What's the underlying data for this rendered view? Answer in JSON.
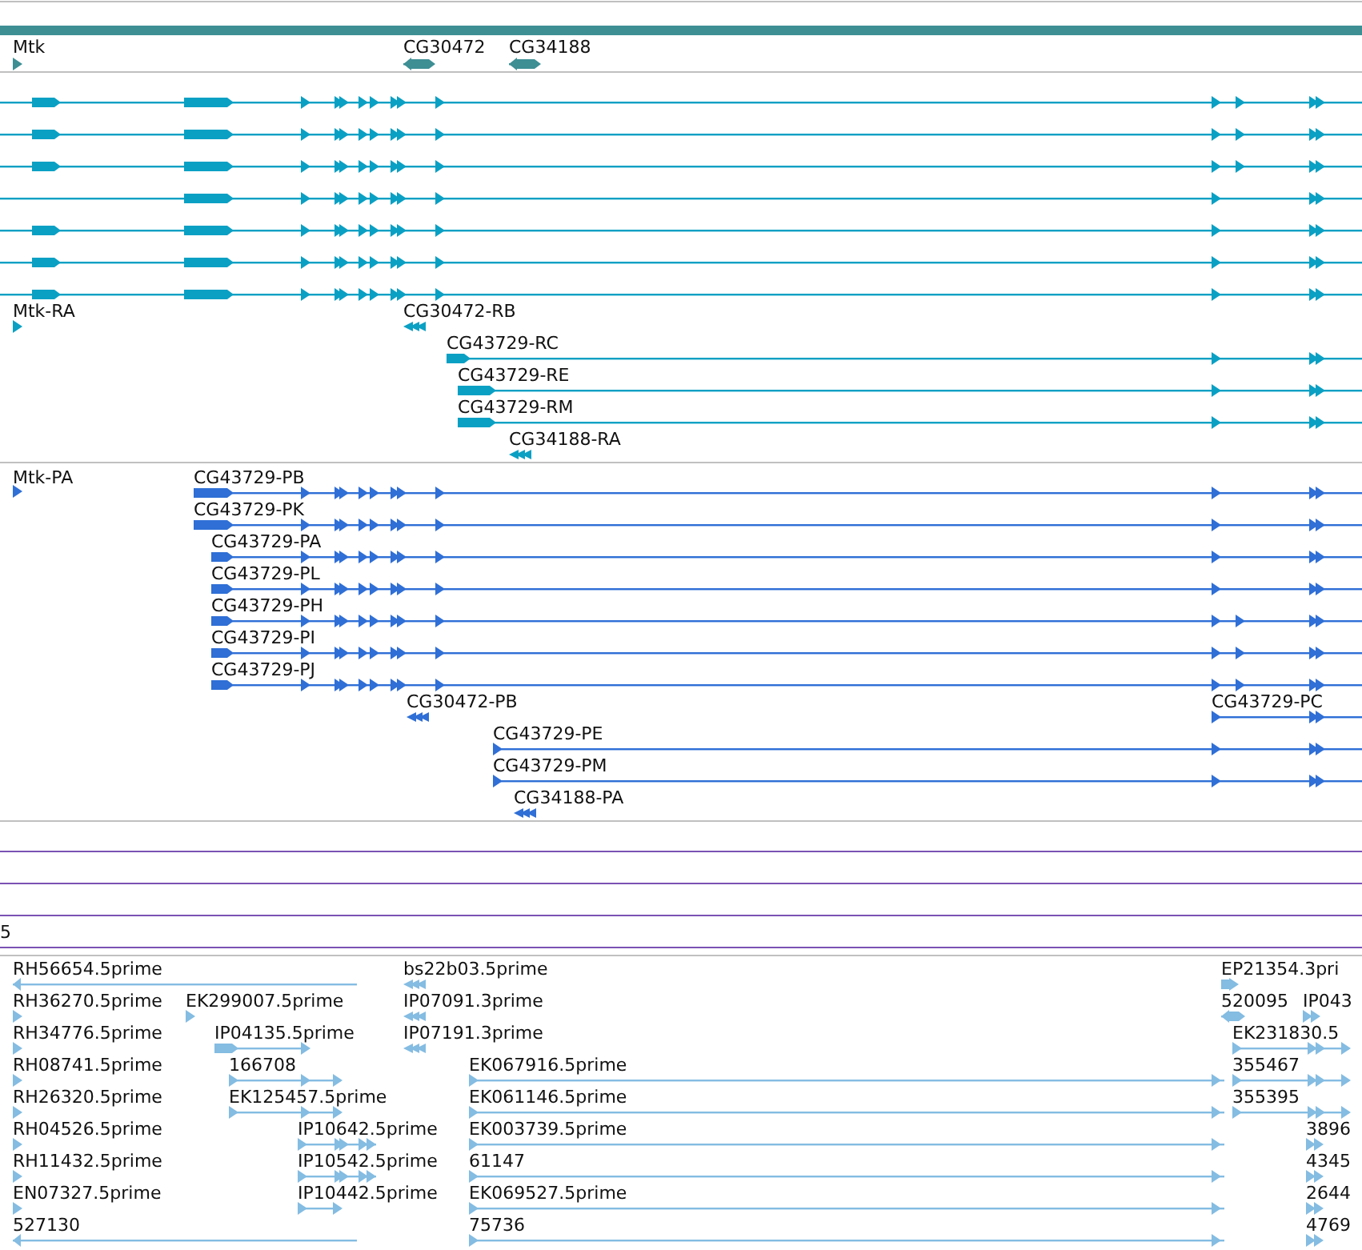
{
  "tracks": [
    {
      "kind": "genes",
      "color": "#3d8f94",
      "features": [
        {
          "label": "Mtk"
        },
        {
          "label": "CG30472"
        },
        {
          "label": "CG34188"
        }
      ]
    },
    {
      "kind": "transcripts",
      "color": "#0aa0c4",
      "features": [
        {
          "label": "Mtk-RA"
        },
        {
          "label": "CG30472-RB"
        },
        {
          "label": "CG43729-RC"
        },
        {
          "label": "CG43729-RE"
        },
        {
          "label": "CG43729-RM"
        },
        {
          "label": "CG34188-RA"
        }
      ]
    },
    {
      "kind": "proteins",
      "color": "#2f6fd6",
      "features": [
        {
          "label": "Mtk-PA"
        },
        {
          "label": "CG43729-PB"
        },
        {
          "label": "CG43729-PK"
        },
        {
          "label": "CG43729-PA"
        },
        {
          "label": "CG43729-PL"
        },
        {
          "label": "CG43729-PH"
        },
        {
          "label": "CG43729-PI"
        },
        {
          "label": "CG43729-PJ"
        },
        {
          "label": "CG30472-PB"
        },
        {
          "label": "CG43729-PC"
        },
        {
          "label": "CG43729-PE"
        },
        {
          "label": "CG43729-PM"
        },
        {
          "label": "CG34188-PA"
        }
      ]
    },
    {
      "kind": "lines",
      "color": "#7a52b4",
      "features": [
        {
          "label": "5"
        }
      ]
    },
    {
      "kind": "ests",
      "color": "#84bce2",
      "features": [
        {
          "label": "RH56654.5prime"
        },
        {
          "label": "bs22b03.5prime"
        },
        {
          "label": "EP21354.3pri"
        },
        {
          "label": "RH36270.5prime"
        },
        {
          "label": "EK299007.5prime"
        },
        {
          "label": "IP07091.3prime"
        },
        {
          "label": "520095"
        },
        {
          "label": "IP043"
        },
        {
          "label": "RH34776.5prime"
        },
        {
          "label": "IP04135.5prime"
        },
        {
          "label": "IP07191.3prime"
        },
        {
          "label": "EK231830.5"
        },
        {
          "label": "RH08741.5prime"
        },
        {
          "label": "166708"
        },
        {
          "label": "EK067916.5prime"
        },
        {
          "label": "355467"
        },
        {
          "label": "RH26320.5prime"
        },
        {
          "label": "EK125457.5prime"
        },
        {
          "label": "EK061146.5prime"
        },
        {
          "label": "355395"
        },
        {
          "label": "RH04526.5prime"
        },
        {
          "label": "IP10642.5prime"
        },
        {
          "label": "EK003739.5prime"
        },
        {
          "label": "3896"
        },
        {
          "label": "RH11432.5prime"
        },
        {
          "label": "IP10542.5prime"
        },
        {
          "label": "61147"
        },
        {
          "label": "4345"
        },
        {
          "label": "EN07327.5prime"
        },
        {
          "label": "IP10442.5prime"
        },
        {
          "label": "EK069527.5prime"
        },
        {
          "label": "2644"
        },
        {
          "label": "527130"
        },
        {
          "label": "75736"
        },
        {
          "label": "4769"
        }
      ]
    }
  ]
}
